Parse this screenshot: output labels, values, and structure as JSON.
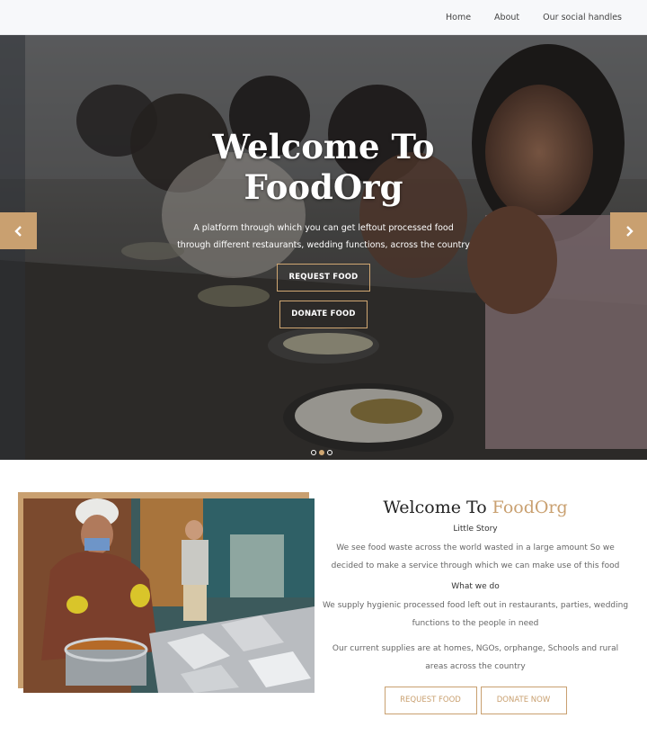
{
  "nav": {
    "links": [
      "Home",
      "About",
      "Our social handles"
    ]
  },
  "hero": {
    "title_line1": "Welcome To",
    "title_line2": "FoodOrg",
    "subtitle_line1": "A platform through which you can get leftout processed food",
    "subtitle_line2": "through different restaurants, wedding functions, across the country",
    "request_label": "REQUEST FOOD",
    "donate_label": "DONATE FOOD",
    "slides_total": 3,
    "active_slide": 2
  },
  "about": {
    "title_prefix": "Welcome To ",
    "title_accent": "FoodOrg",
    "little_story_heading": "Little Story",
    "little_story_text": "We see food waste across the world wasted in a large amount So we decided to make a service through which we can make use of this food",
    "what_we_do_heading": "What we do",
    "what_we_do_text": "We supply hygienic processed food left out in restaurants, parties, wedding functions to the people in need",
    "supplies_text": "Our current supplies are at homes, NGOs, orphange, Schools and rural areas across the country",
    "request_label": "REQUEST FOOD",
    "donate_label": "DONATE NOW"
  },
  "colors": {
    "accent": "#c9a070",
    "nav_bg": "#f7f8fa"
  },
  "icons": {
    "prev": "chevron-left-icon",
    "next": "chevron-right-icon"
  }
}
